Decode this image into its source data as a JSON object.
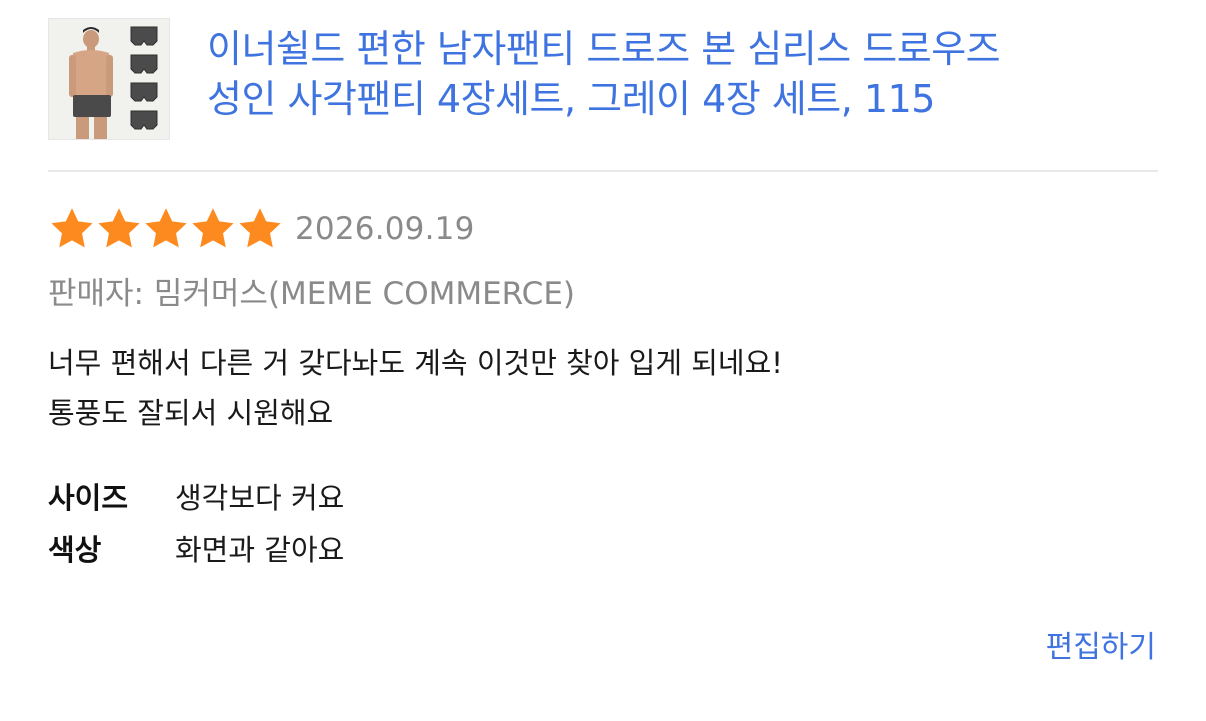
{
  "product": {
    "title_line1": "이너쉴드 편한 남자팬티 드로즈 본 심리스 드로우즈",
    "title_line2": "성인 사각팬티 4장세트, 그레이 4장 세트, 115",
    "thumbnail_icon": "product-thumbnail"
  },
  "review": {
    "rating": 5,
    "rating_max": 5,
    "date": "2026.09.19",
    "seller": "판매자: 밈커머스(MEME COMMERCE)",
    "body_line1": "너무 편해서 다른 거 갖다놔도 계속 이것만 찾아 입게 되네요!",
    "body_line2": "통풍도 잘되서 시원해요",
    "attributes": [
      {
        "key": "사이즈",
        "value": "생각보다 커요"
      },
      {
        "key": "색상",
        "value": "화면과 같아요"
      }
    ],
    "edit_label": "편집하기"
  },
  "colors": {
    "link_blue": "#3f74e0",
    "star_orange": "#fd8a1e",
    "muted_gray": "#8a8a8a"
  }
}
